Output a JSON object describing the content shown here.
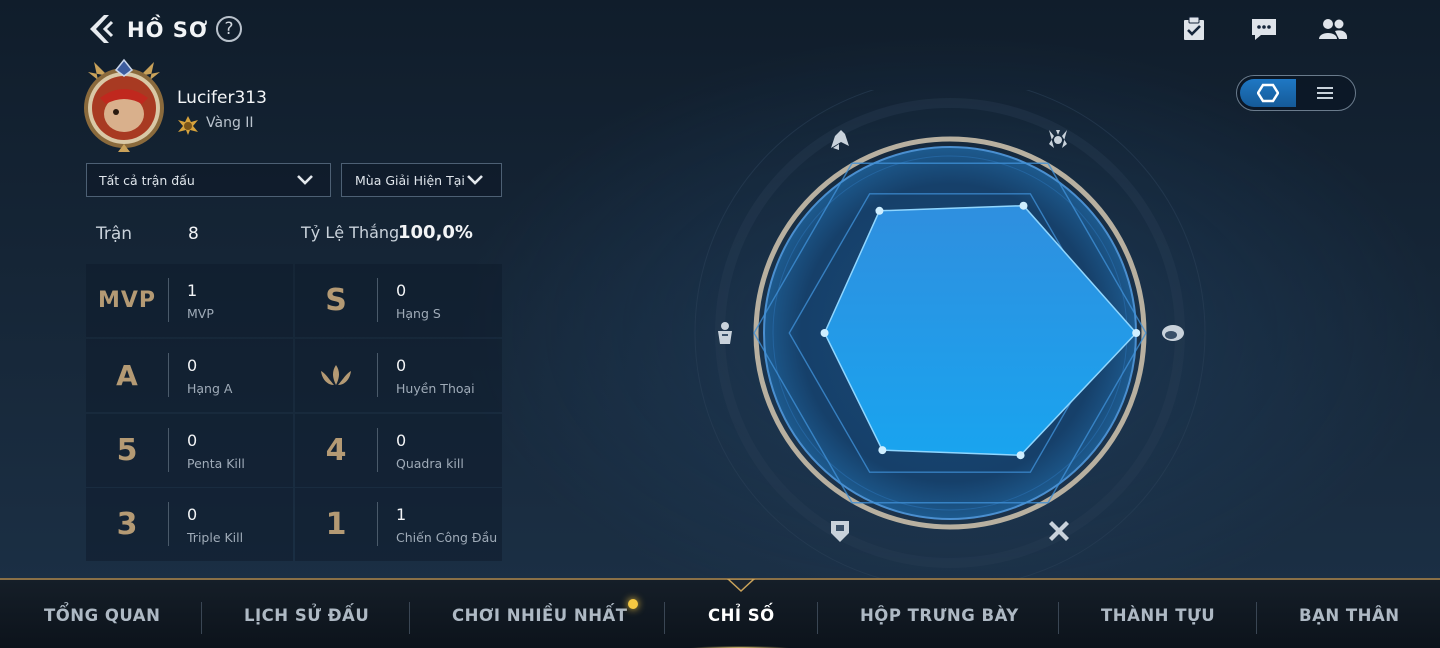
{
  "header": {
    "title": "HỒ SƠ",
    "help_symbol": "?",
    "icons": [
      "back-icon",
      "help-icon",
      "checklist-icon",
      "chat-icon",
      "friends-icon"
    ]
  },
  "profile": {
    "username": "Lucifer313",
    "rank": "Vàng II"
  },
  "filters": {
    "match_type": "Tất cả trận đấu",
    "season": "Mùa Giải Hiện Tại"
  },
  "summary": {
    "matches_label": "Trận",
    "matches_value": "8",
    "winrate_label": "Tỷ Lệ Thắng",
    "winrate_value": "100,0%"
  },
  "stats": [
    {
      "icon_text": "MVP",
      "icon": "mvp-icon",
      "value": "1",
      "label": "MVP"
    },
    {
      "icon_text": "S",
      "icon": "rank-s-icon",
      "value": "0",
      "label": "Hạng S"
    },
    {
      "icon_text": "A",
      "icon": "rank-a-icon",
      "value": "0",
      "label": "Hạng A"
    },
    {
      "icon_text": "",
      "icon": "legendary-icon",
      "value": "0",
      "label": "Huyền Thoại"
    },
    {
      "icon_text": "5",
      "icon": "penta-kill-icon",
      "value": "0",
      "label": "Penta Kill"
    },
    {
      "icon_text": "4",
      "icon": "quadra-kill-icon",
      "value": "0",
      "label": "Quadra kill"
    },
    {
      "icon_text": "3",
      "icon": "triple-kill-icon",
      "value": "0",
      "label": "Triple Kill"
    },
    {
      "icon_text": "1",
      "icon": "first-blood-icon",
      "value": "1",
      "label": "Chiến Công Đầu"
    }
  ],
  "radar_axes": [
    "assassin-icon",
    "mage-icon",
    "farm-icon",
    "tank-icon",
    "fight-icon",
    "support-icon"
  ],
  "radar_values": [
    0.72,
    0.75,
    0.95,
    0.72,
    0.69,
    0.64
  ],
  "colors": {
    "accent_blue": "#1f8fe0",
    "gold": "#b49a74",
    "notification": "#f5c842"
  },
  "tabs": [
    {
      "label": "TỔNG QUAN",
      "active": false
    },
    {
      "label": "LỊCH SỬ ĐẤU",
      "active": false
    },
    {
      "label": "CHƠI NHIỀU NHẤT",
      "active": false,
      "notification": true
    },
    {
      "label": "CHỈ SỐ",
      "active": true
    },
    {
      "label": "HỘP TRƯNG BÀY",
      "active": false
    },
    {
      "label": "THÀNH TỰU",
      "active": false
    },
    {
      "label": "BẠN THÂN",
      "active": false
    }
  ]
}
